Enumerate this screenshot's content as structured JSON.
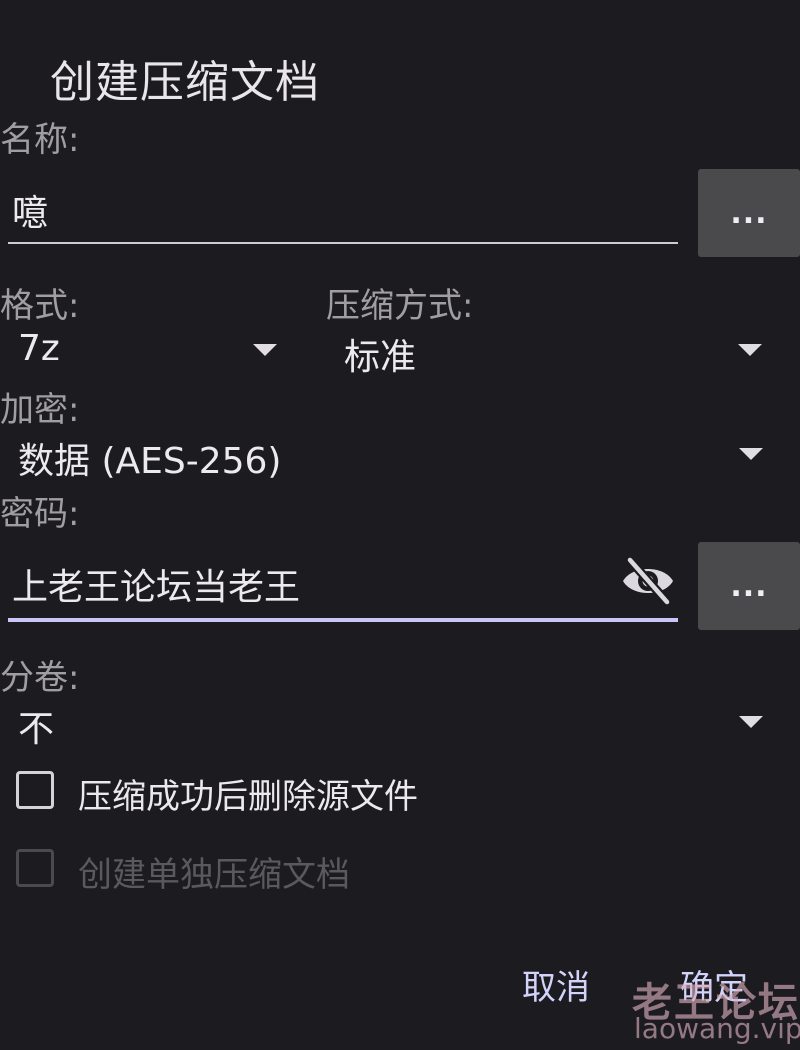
{
  "dialog": {
    "title": "创建压缩文档",
    "name": {
      "label": "名称:",
      "value": "噫",
      "more_label": "..."
    },
    "format": {
      "label": "格式:",
      "value": "7z"
    },
    "compression": {
      "label": "压缩方式:",
      "value": "标准"
    },
    "encryption": {
      "label": "加密:",
      "value": "数据 (AES-256)"
    },
    "password": {
      "label": "密码:",
      "value": "上老王论坛当老王",
      "more_label": "..."
    },
    "split": {
      "label": "分卷:",
      "value": "不"
    },
    "options": {
      "delete_source": {
        "label": "压缩成功后删除源文件",
        "checked": false,
        "enabled": true
      },
      "separate_archives": {
        "label": "创建单独压缩文档",
        "checked": false,
        "enabled": false
      }
    },
    "actions": {
      "cancel": "取消",
      "confirm": "确定"
    }
  },
  "watermark": {
    "main": "老王论坛",
    "sub": "laowang.vip"
  },
  "icons": {
    "password_toggle": "eye-off-icon",
    "dropdown": "chevron-down-icon"
  },
  "colors": {
    "background": "#1c1b1f",
    "accent": "#c9c5f7",
    "button": "#4a4a4d"
  }
}
